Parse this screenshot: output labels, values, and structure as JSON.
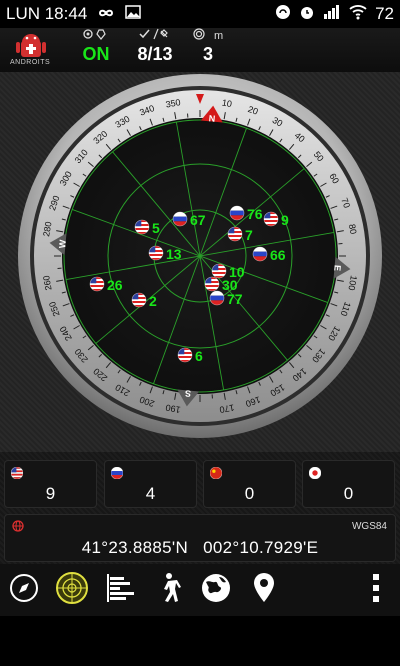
{
  "statusbar": {
    "day_time": "LUN 18:44",
    "battery": "72",
    "left_icons": [
      "infinity-icon",
      "image-icon"
    ],
    "right_icons": [
      "headset-icon",
      "alarm-icon",
      "signal-icon",
      "wifi-icon"
    ]
  },
  "header": {
    "app_logo_text": "ANDROITS",
    "gps_status": {
      "icon": "gps-icon",
      "value": "ON"
    },
    "satellites": {
      "icon": "check-satellite-icon",
      "value": "8/13"
    },
    "accuracy": {
      "icon": "target-icon",
      "unit": "m",
      "value": "3"
    }
  },
  "compass": {
    "north_label": "N",
    "east_label": "E",
    "south_label": "S",
    "west_label": "W",
    "degree_ticks": [
      "10",
      "20",
      "30",
      "40",
      "50",
      "60",
      "70",
      "80",
      "100",
      "110",
      "120",
      "130",
      "140",
      "150",
      "160",
      "170",
      "190",
      "200",
      "210",
      "220",
      "230",
      "240",
      "250",
      "260",
      "280",
      "290",
      "300",
      "310",
      "320",
      "330",
      "340",
      "350"
    ],
    "sat_color": "#19e619",
    "grid_color": "#2aa02a"
  },
  "satellites": [
    {
      "id": "5",
      "flag": "us"
    },
    {
      "id": "67",
      "flag": "ru"
    },
    {
      "id": "76",
      "flag": "ru"
    },
    {
      "id": "9",
      "flag": "us"
    },
    {
      "id": "7",
      "flag": "us"
    },
    {
      "id": "13",
      "flag": "us"
    },
    {
      "id": "66",
      "flag": "ru"
    },
    {
      "id": "10",
      "flag": "us"
    },
    {
      "id": "26",
      "flag": "us"
    },
    {
      "id": "30",
      "flag": "us"
    },
    {
      "id": "2",
      "flag": "us"
    },
    {
      "id": "77",
      "flag": "ru"
    },
    {
      "id": "6",
      "flag": "us"
    }
  ],
  "constellations": [
    {
      "name": "gps-usa",
      "flag": "us",
      "count": "9"
    },
    {
      "name": "glonass-russia",
      "flag": "ru",
      "count": "4"
    },
    {
      "name": "beidou-china",
      "flag": "cn",
      "count": "0"
    },
    {
      "name": "qzss-japan",
      "flag": "jp",
      "count": "0"
    }
  ],
  "position": {
    "datum": "WGS84",
    "coords": "41°23.8885'N   002°10.7929'E"
  },
  "bottom_tabs": [
    {
      "name": "tab-compass",
      "icon": "compass-icon"
    },
    {
      "name": "tab-radar",
      "icon": "radar-icon"
    },
    {
      "name": "tab-signal-bars",
      "icon": "bars-icon"
    },
    {
      "name": "tab-walk",
      "icon": "walk-icon"
    },
    {
      "name": "tab-globe",
      "icon": "globe-icon"
    },
    {
      "name": "tab-location",
      "icon": "pin-icon"
    },
    {
      "name": "tab-menu",
      "icon": "more-vert-icon"
    }
  ]
}
